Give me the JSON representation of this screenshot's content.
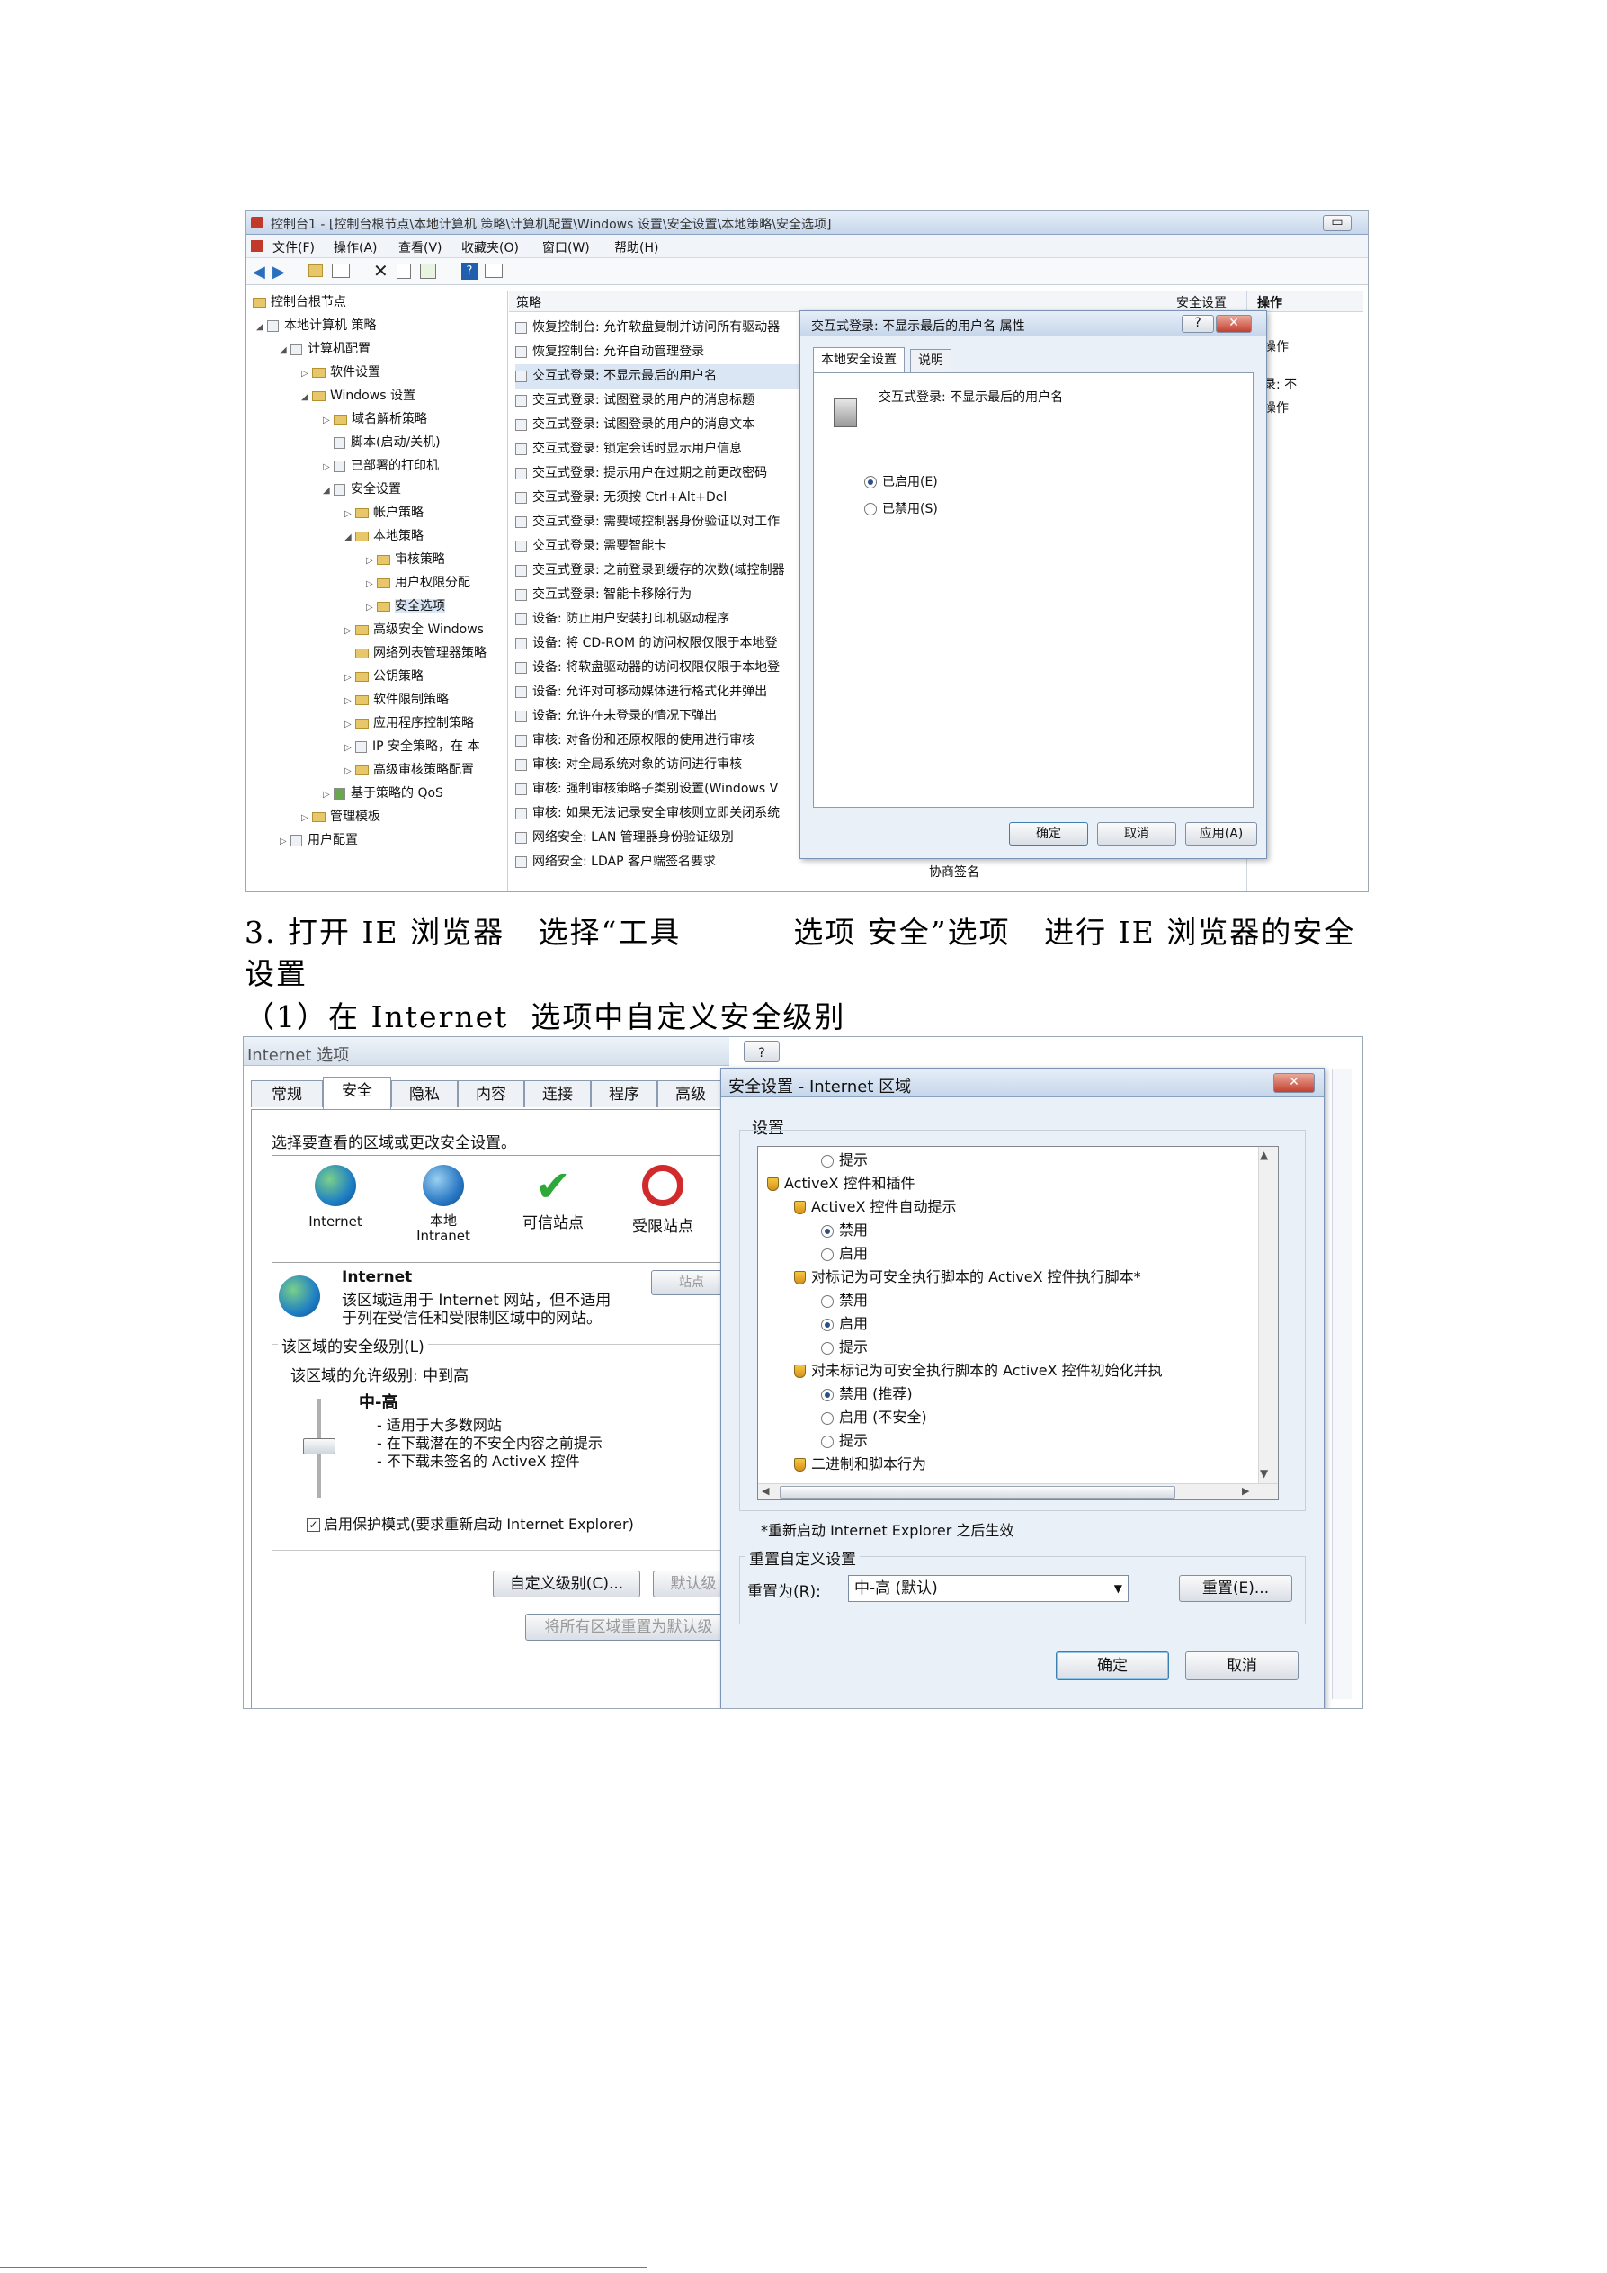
{
  "screenshot1": {
    "title": "控制台1 - [控制台根节点\\本地计算机 策略\\计算机配置\\Windows 设置\\安全设置\\本地策略\\安全选项]",
    "menu": [
      "文件(F)",
      "操作(A)",
      "查看(V)",
      "收藏夹(O)",
      "窗口(W)",
      "帮助(H)"
    ],
    "tree": [
      "控制台根节点",
      "本地计算机 策略",
      "计算机配置",
      "软件设置",
      "Windows 设置",
      "域名解析策略",
      "脚本(启动/关机)",
      "已部署的打印机",
      "安全设置",
      "帐户策略",
      "本地策略",
      "审核策略",
      "用户权限分配",
      "安全选项",
      "高级安全 Windows",
      "网络列表管理器策略",
      "公钥策略",
      "软件限制策略",
      "应用程序控制策略",
      "IP 安全策略，在 本",
      "高级审核策略配置",
      "基于策略的 QoS",
      "管理模板",
      "用户配置"
    ],
    "column_policy": "策略",
    "column_setting": "安全设置",
    "column_action": "操作",
    "policies": [
      "恢复控制台: 允许软盘复制并访问所有驱动器",
      "恢复控制台: 允许自动管理登录",
      "交互式登录: 不显示最后的用户名",
      "交互式登录: 试图登录的用户的消息标题",
      "交互式登录: 试图登录的用户的消息文本",
      "交互式登录: 锁定会话时显示用户信息",
      "交互式登录: 提示用户在过期之前更改密码",
      "交互式登录: 无须按 Ctrl+Alt+Del",
      "交互式登录: 需要域控制器身份验证以对工作",
      "交互式登录: 需要智能卡",
      "交互式登录: 之前登录到缓存的次数(域控制器",
      "交互式登录: 智能卡移除行为",
      "设备: 防止用户安装打印机驱动程序",
      "设备: 将 CD-ROM 的访问权限仅限于本地登",
      "设备: 将软盘驱动器的访问权限仅限于本地登",
      "设备: 允许对可移动媒体进行格式化并弹出",
      "设备: 允许在未登录的情况下弹出",
      "审核: 对备份和还原权限的使用进行审核",
      "审核: 对全局系统对象的访问进行审核",
      "审核: 强制审核策略子类别设置(Windows V",
      "审核: 如果无法记录安全审核则立即关闭系统",
      "网络安全: LAN 管理器身份验证级别",
      "网络安全: LDAP 客户端签名要求"
    ],
    "setting_last": "协商签名",
    "action_items": [
      "项",
      "多操作",
      "登录: 不",
      "多操作"
    ],
    "dialog": {
      "title": "交互式登录: 不显示最后的用户名 属性",
      "tabs": [
        "本地安全设置",
        "说明"
      ],
      "policy_name": "交互式登录: 不显示最后的用户名",
      "option_enabled": "已启用(E)",
      "option_disabled": "已禁用(S)",
      "btn_ok": "确定",
      "btn_cancel": "取消",
      "btn_apply": "应用(A)",
      "help": "?"
    }
  },
  "text": {
    "step3_line1": "3. 打开 IE 浏览器   选择“工具          选项 安全”选项   进行 IE 浏览器的安全",
    "step3_line2": "设置",
    "step3_sub": "（1）在 Internet  选项中自定义安全级别"
  },
  "screenshot2": {
    "options_title": "Internet 选项",
    "tabs": [
      "常规",
      "安全",
      "隐私",
      "内容",
      "连接",
      "程序",
      "高级"
    ],
    "zone_prompt": "选择要查看的区域或更改安全设置。",
    "zones": [
      "Internet",
      "本地\nIntranet",
      "可信站点",
      "受限站点"
    ],
    "zone_name": "Internet",
    "zone_desc": "该区域适用于 Internet 网站，但不适用于列在受信任和受限制区域中的网站。",
    "sites_button": "站点",
    "level_group": "该区域的安全级别(L)",
    "allowed_levels": "该区域的允许级别: 中到高",
    "level_name": "中-高",
    "level_bullets": [
      "- 适用于大多数网站",
      "- 在下载潜在的不安全内容之前提示",
      "- 不下载未签名的 ActiveX 控件"
    ],
    "protected_mode": "启用保护模式(要求重新启动 Internet Explorer)",
    "custom_level_btn": "自定义级别(C)...",
    "default_level_btn": "默认级",
    "reset_all_btn": "将所有区域重置为默认级",
    "security_title": "安全设置 - Internet 区域",
    "settings_label": "设置",
    "settings_items": [
      {
        "type": "radio",
        "label": "提示",
        "on": false
      },
      {
        "type": "group",
        "label": "ActiveX 控件和插件"
      },
      {
        "type": "sub",
        "label": "ActiveX 控件自动提示"
      },
      {
        "type": "radio",
        "label": "禁用",
        "on": true
      },
      {
        "type": "radio",
        "label": "启用",
        "on": false
      },
      {
        "type": "sub",
        "label": "对标记为可安全执行脚本的 ActiveX 控件执行脚本*"
      },
      {
        "type": "radio",
        "label": "禁用",
        "on": false
      },
      {
        "type": "radio",
        "label": "启用",
        "on": true
      },
      {
        "type": "radio",
        "label": "提示",
        "on": false
      },
      {
        "type": "sub",
        "label": "对未标记为可安全执行脚本的 ActiveX 控件初始化并执"
      },
      {
        "type": "radio",
        "label": "禁用 (推荐)",
        "on": true
      },
      {
        "type": "radio",
        "label": "启用 (不安全)",
        "on": false
      },
      {
        "type": "radio",
        "label": "提示",
        "on": false
      },
      {
        "type": "sub",
        "label": "二进制和脚本行为"
      }
    ],
    "restart_note": "*重新启动 Internet Explorer 之后生效",
    "reset_group": "重置自定义设置",
    "reset_to_label": "重置为(R):",
    "reset_value": "中-高 (默认)",
    "reset_btn": "重置(E)...",
    "btn_ok": "确定",
    "btn_cancel": "取消"
  }
}
